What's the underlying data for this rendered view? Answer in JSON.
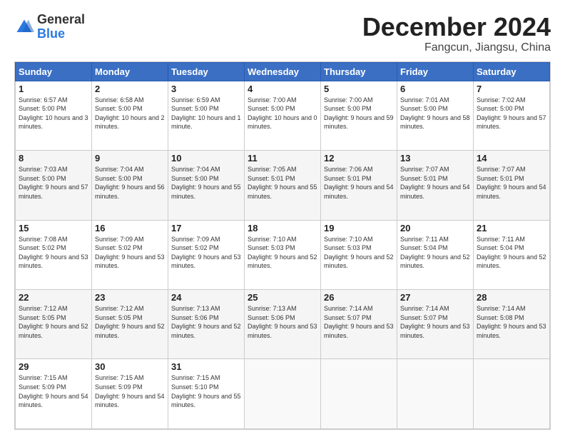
{
  "header": {
    "logo_general": "General",
    "logo_blue": "Blue",
    "month_title": "December 2024",
    "location": "Fangcun, Jiangsu, China"
  },
  "days_of_week": [
    "Sunday",
    "Monday",
    "Tuesday",
    "Wednesday",
    "Thursday",
    "Friday",
    "Saturday"
  ],
  "weeks": [
    [
      {
        "day": "1",
        "rise": "6:57 AM",
        "set": "5:00 PM",
        "hours": "10 hours and 3 minutes."
      },
      {
        "day": "2",
        "rise": "6:58 AM",
        "set": "5:00 PM",
        "hours": "10 hours and 2 minutes."
      },
      {
        "day": "3",
        "rise": "6:59 AM",
        "set": "5:00 PM",
        "hours": "10 hours and 1 minute."
      },
      {
        "day": "4",
        "rise": "7:00 AM",
        "set": "5:00 PM",
        "hours": "10 hours and 0 minutes."
      },
      {
        "day": "5",
        "rise": "7:00 AM",
        "set": "5:00 PM",
        "hours": "9 hours and 59 minutes."
      },
      {
        "day": "6",
        "rise": "7:01 AM",
        "set": "5:00 PM",
        "hours": "9 hours and 58 minutes."
      },
      {
        "day": "7",
        "rise": "7:02 AM",
        "set": "5:00 PM",
        "hours": "9 hours and 57 minutes."
      }
    ],
    [
      {
        "day": "8",
        "rise": "7:03 AM",
        "set": "5:00 PM",
        "hours": "9 hours and 57 minutes."
      },
      {
        "day": "9",
        "rise": "7:04 AM",
        "set": "5:00 PM",
        "hours": "9 hours and 56 minutes."
      },
      {
        "day": "10",
        "rise": "7:04 AM",
        "set": "5:00 PM",
        "hours": "9 hours and 55 minutes."
      },
      {
        "day": "11",
        "rise": "7:05 AM",
        "set": "5:01 PM",
        "hours": "9 hours and 55 minutes."
      },
      {
        "day": "12",
        "rise": "7:06 AM",
        "set": "5:01 PM",
        "hours": "9 hours and 54 minutes."
      },
      {
        "day": "13",
        "rise": "7:07 AM",
        "set": "5:01 PM",
        "hours": "9 hours and 54 minutes."
      },
      {
        "day": "14",
        "rise": "7:07 AM",
        "set": "5:01 PM",
        "hours": "9 hours and 54 minutes."
      }
    ],
    [
      {
        "day": "15",
        "rise": "7:08 AM",
        "set": "5:02 PM",
        "hours": "9 hours and 53 minutes."
      },
      {
        "day": "16",
        "rise": "7:09 AM",
        "set": "5:02 PM",
        "hours": "9 hours and 53 minutes."
      },
      {
        "day": "17",
        "rise": "7:09 AM",
        "set": "5:02 PM",
        "hours": "9 hours and 53 minutes."
      },
      {
        "day": "18",
        "rise": "7:10 AM",
        "set": "5:03 PM",
        "hours": "9 hours and 52 minutes."
      },
      {
        "day": "19",
        "rise": "7:10 AM",
        "set": "5:03 PM",
        "hours": "9 hours and 52 minutes."
      },
      {
        "day": "20",
        "rise": "7:11 AM",
        "set": "5:04 PM",
        "hours": "9 hours and 52 minutes."
      },
      {
        "day": "21",
        "rise": "7:11 AM",
        "set": "5:04 PM",
        "hours": "9 hours and 52 minutes."
      }
    ],
    [
      {
        "day": "22",
        "rise": "7:12 AM",
        "set": "5:05 PM",
        "hours": "9 hours and 52 minutes."
      },
      {
        "day": "23",
        "rise": "7:12 AM",
        "set": "5:05 PM",
        "hours": "9 hours and 52 minutes."
      },
      {
        "day": "24",
        "rise": "7:13 AM",
        "set": "5:06 PM",
        "hours": "9 hours and 52 minutes."
      },
      {
        "day": "25",
        "rise": "7:13 AM",
        "set": "5:06 PM",
        "hours": "9 hours and 53 minutes."
      },
      {
        "day": "26",
        "rise": "7:14 AM",
        "set": "5:07 PM",
        "hours": "9 hours and 53 minutes."
      },
      {
        "day": "27",
        "rise": "7:14 AM",
        "set": "5:07 PM",
        "hours": "9 hours and 53 minutes."
      },
      {
        "day": "28",
        "rise": "7:14 AM",
        "set": "5:08 PM",
        "hours": "9 hours and 53 minutes."
      }
    ],
    [
      {
        "day": "29",
        "rise": "7:15 AM",
        "set": "5:09 PM",
        "hours": "9 hours and 54 minutes."
      },
      {
        "day": "30",
        "rise": "7:15 AM",
        "set": "5:09 PM",
        "hours": "9 hours and 54 minutes."
      },
      {
        "day": "31",
        "rise": "7:15 AM",
        "set": "5:10 PM",
        "hours": "9 hours and 55 minutes."
      },
      null,
      null,
      null,
      null
    ]
  ]
}
